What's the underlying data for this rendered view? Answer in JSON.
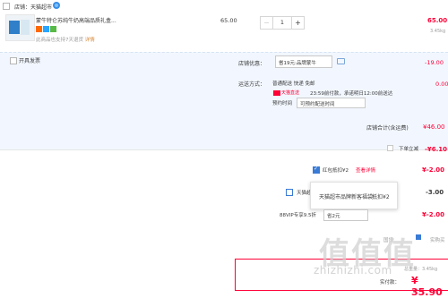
{
  "store": {
    "name": "店铺：天猫超市"
  },
  "product": {
    "title": "蒙牛特仑苏纯牛奶高端品质礼盒...",
    "note": "此商品也支持7天退货",
    "note_link": "详情",
    "unit_price": "65.00",
    "quantity": "1",
    "subtotal": "65.00",
    "weight": "3.45kg"
  },
  "options": {
    "invoice_label": "开具发票",
    "discount_label": "店铺优惠：",
    "discount_select": "省19元:品牌蒙牛",
    "discount_value": "-19.00",
    "shipping_label": "运送方式：",
    "shipping_line": "普通配送 快递 免邮",
    "tmall_badge": "天猫直送",
    "shipping_time": "23:59前付款，承诺明日12:00前送达",
    "preorder_label": "预约时间",
    "preorder_input": "可预约配送时间",
    "shipping_value": "0.00",
    "store_total_label": "店铺合计(含运费)",
    "store_total_value": "¥46.00"
  },
  "extras": {
    "instant_label": "下单立减",
    "instant_value": "-¥6.10",
    "hongbao_label": "红包抵扣¥2",
    "hongbao_link": "查看详情",
    "hongbao_value": "¥-2.00",
    "tmall_coupon_label": "天猫超",
    "tmall_coupon_value": "-3.00",
    "popup_name": "天猫超市品牌新客福袋",
    "popup_discount": "抵扣¥2",
    "vip_label": "88VIP专享9.5折",
    "vip_select": "省2元",
    "vip_value": "¥-2.00",
    "faint_left": "国贷",
    "faint_right": "实购买"
  },
  "total": {
    "weight": "总重量：3.45kg",
    "label": "实付款：",
    "value": "¥ 35.90"
  },
  "watermark": {
    "logo": "值值值",
    "text": "zhizhizhi.com"
  },
  "colors": {
    "accent": "#ff0036",
    "panel": "#f2f7ff",
    "link_blue": "#3a7bd5"
  }
}
